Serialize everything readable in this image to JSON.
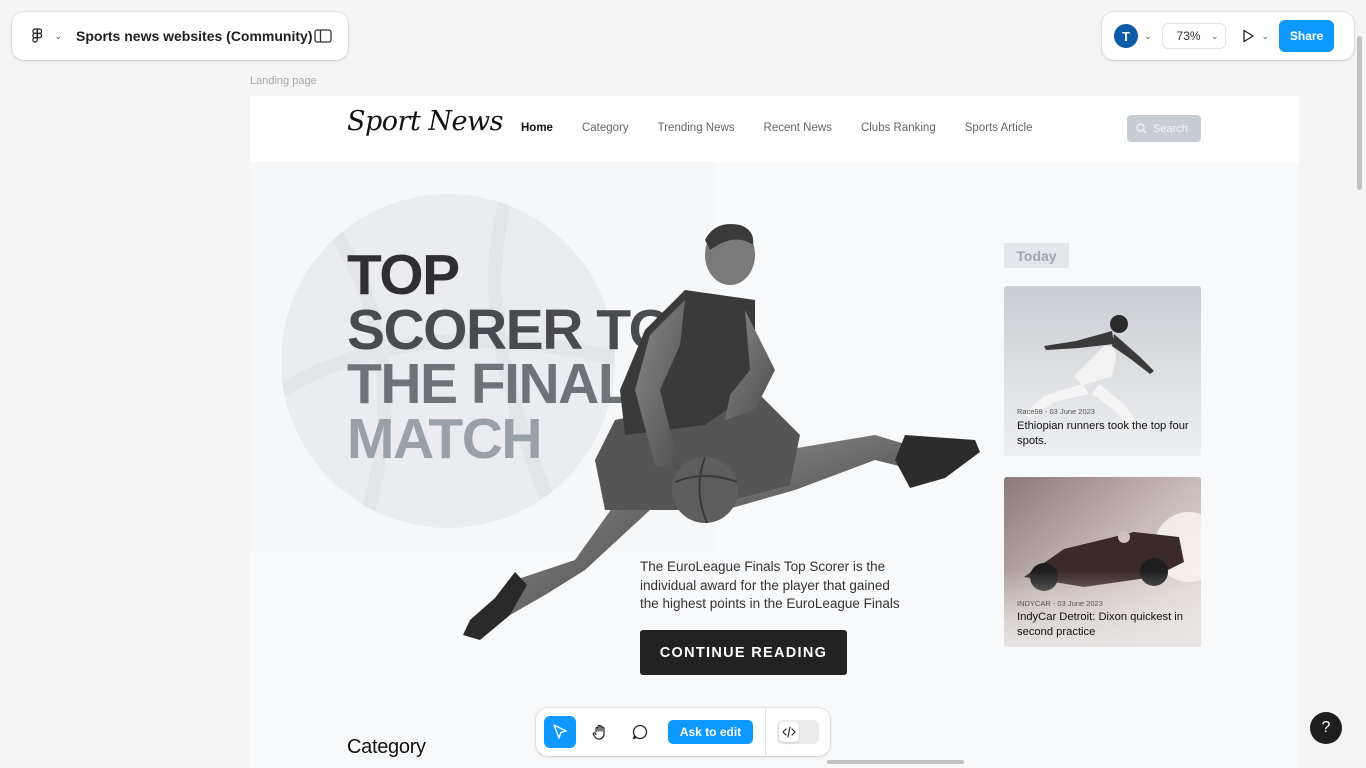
{
  "app": {
    "file_title": "Sports news websites (Community)",
    "avatar_initial": "T",
    "zoom_level": "73%",
    "share_label": "Share",
    "frame_label": "Landing page"
  },
  "site": {
    "logo": "Sport News",
    "nav": [
      "Home",
      "Category",
      "Trending News",
      "Recent News",
      "Clubs Ranking",
      "Sports Article"
    ],
    "search_placeholder": "Search",
    "headline": [
      "TOP",
      "SCORER TO",
      "THE FINAL",
      "MATCH"
    ],
    "blurb": "The EuroLeague Finals Top Scorer is the individual award for the player that gained the highest points in the EuroLeague Finals",
    "cta": "CONTINUE READING",
    "sidebar_heading": "Today",
    "cards": [
      {
        "meta": "Race98 - 03 June 2023",
        "title": "Ethiopian runners took the top four spots."
      },
      {
        "meta": "INDYCAR - 03 June 2023",
        "title": "IndyCar Detroit: Dixon quickest in second practice"
      }
    ],
    "category_heading": "Category"
  },
  "toolbar": {
    "ask_label": "Ask to edit"
  },
  "help_label": "?",
  "colors": {
    "accent": "#0d99ff",
    "avatar": "#0d5ba8",
    "cta_bg": "#222222"
  }
}
